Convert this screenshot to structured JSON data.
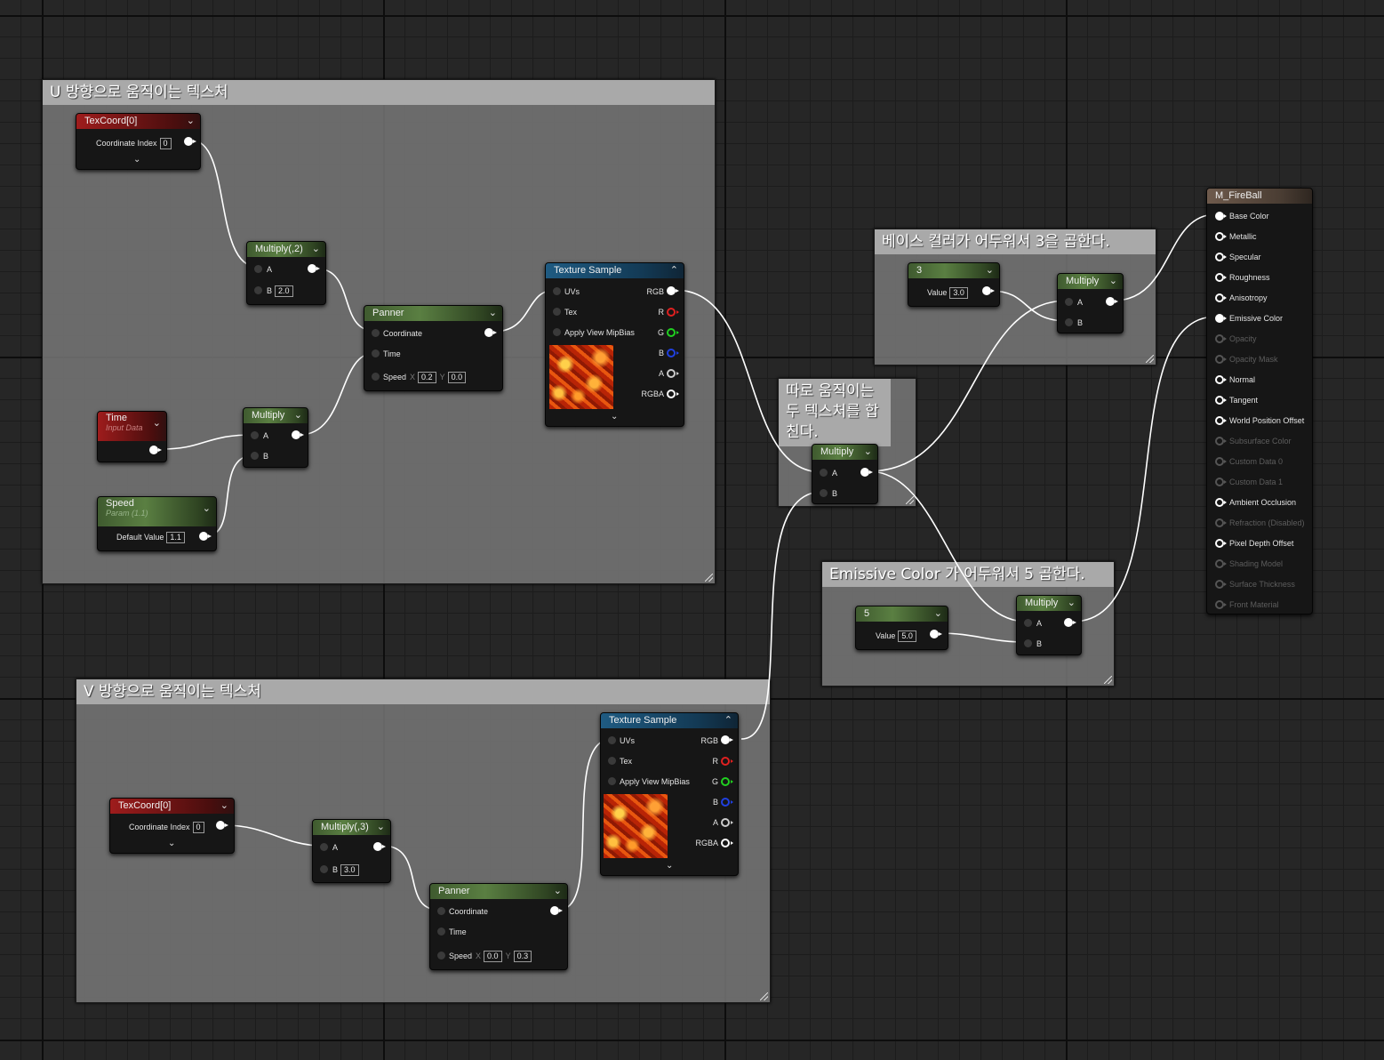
{
  "comments": {
    "u_move": {
      "title": "U 방향으로 움직이는 텍스처"
    },
    "v_move": {
      "title": "V 방향으로 움직이는 텍스처"
    },
    "base_color": {
      "title": "베이스 컬러가 어두워서 3을 곱한다."
    },
    "combine": {
      "title": "따로 움직이는 두 텍스처를 합친다."
    },
    "emissive": {
      "title": "Emissive Color 가 어두워서 5 곱한다."
    }
  },
  "nodes": {
    "texcoord_u": {
      "title": "TexCoord[0]",
      "label": "Coordinate Index",
      "value": "0"
    },
    "multiply_u": {
      "title": "Multiply(,2)",
      "a": "A",
      "b": "B",
      "b_value": "2.0"
    },
    "time": {
      "title": "Time",
      "subtitle": "Input Data"
    },
    "multiply_time": {
      "title": "Multiply",
      "a": "A",
      "b": "B"
    },
    "speed": {
      "title": "Speed",
      "subtitle": "Param (1.1)",
      "label": "Default Value",
      "value": "1.1"
    },
    "panner_u": {
      "title": "Panner",
      "coordinate": "Coordinate",
      "time": "Time",
      "speed": "Speed",
      "x_label": "X",
      "x": "0.2",
      "y_label": "Y",
      "y": "0.0"
    },
    "texsample_u": {
      "title": "Texture Sample",
      "in": [
        "UVs",
        "Tex",
        "Apply View MipBias"
      ],
      "out": [
        "RGB",
        "R",
        "G",
        "B",
        "A",
        "RGBA"
      ]
    },
    "const3": {
      "title": "3",
      "label": "Value",
      "value": "3.0"
    },
    "multiply_base": {
      "title": "Multiply",
      "a": "A",
      "b": "B"
    },
    "multiply_combine": {
      "title": "Multiply",
      "a": "A",
      "b": "B"
    },
    "const5": {
      "title": "5",
      "label": "Value",
      "value": "5.0"
    },
    "multiply_emissive": {
      "title": "Multiply",
      "a": "A",
      "b": "B"
    },
    "texcoord_v": {
      "title": "TexCoord[0]",
      "label": "Coordinate Index",
      "value": "0"
    },
    "multiply_v": {
      "title": "Multiply(,3)",
      "a": "A",
      "b": "B",
      "b_value": "3.0"
    },
    "panner_v": {
      "title": "Panner",
      "coordinate": "Coordinate",
      "time": "Time",
      "speed": "Speed",
      "x_label": "X",
      "x": "0.0",
      "y_label": "Y",
      "y": "0.3"
    },
    "texsample_v": {
      "title": "Texture Sample",
      "in": [
        "UVs",
        "Tex",
        "Apply View MipBias"
      ],
      "out": [
        "RGB",
        "R",
        "G",
        "B",
        "A",
        "RGBA"
      ]
    }
  },
  "material": {
    "title": "M_FireBall",
    "pins": [
      {
        "label": "Base Color",
        "state": "connected"
      },
      {
        "label": "Metallic",
        "state": "enabled"
      },
      {
        "label": "Specular",
        "state": "enabled"
      },
      {
        "label": "Roughness",
        "state": "enabled"
      },
      {
        "label": "Anisotropy",
        "state": "enabled"
      },
      {
        "label": "Emissive Color",
        "state": "connected"
      },
      {
        "label": "Opacity",
        "state": "disabled"
      },
      {
        "label": "Opacity Mask",
        "state": "disabled"
      },
      {
        "label": "Normal",
        "state": "enabled"
      },
      {
        "label": "Tangent",
        "state": "enabled"
      },
      {
        "label": "World Position Offset",
        "state": "enabled"
      },
      {
        "label": "Subsurface Color",
        "state": "disabled"
      },
      {
        "label": "Custom Data 0",
        "state": "disabled"
      },
      {
        "label": "Custom Data 1",
        "state": "disabled"
      },
      {
        "label": "Ambient Occlusion",
        "state": "enabled"
      },
      {
        "label": "Refraction (Disabled)",
        "state": "disabled"
      },
      {
        "label": "Pixel Depth Offset",
        "state": "enabled"
      },
      {
        "label": "Shading Model",
        "state": "disabled"
      },
      {
        "label": "Surface Thickness",
        "state": "disabled"
      },
      {
        "label": "Front Material",
        "state": "disabled"
      }
    ]
  },
  "icons": {
    "dropdown": "chevron-down-icon",
    "collapse": "chevron-up-icon",
    "expand": "expand-arrow-icon",
    "resize": "resize-handle-icon"
  },
  "colors": {
    "pin_red": "#e02020",
    "pin_green": "#20d020",
    "pin_blue": "#2040e0",
    "header_red": "#9e1c1c",
    "header_green": "#5a7f42",
    "header_blue": "#1f5b82",
    "header_material": "#6e5a4c",
    "wire": "#ffffff"
  }
}
